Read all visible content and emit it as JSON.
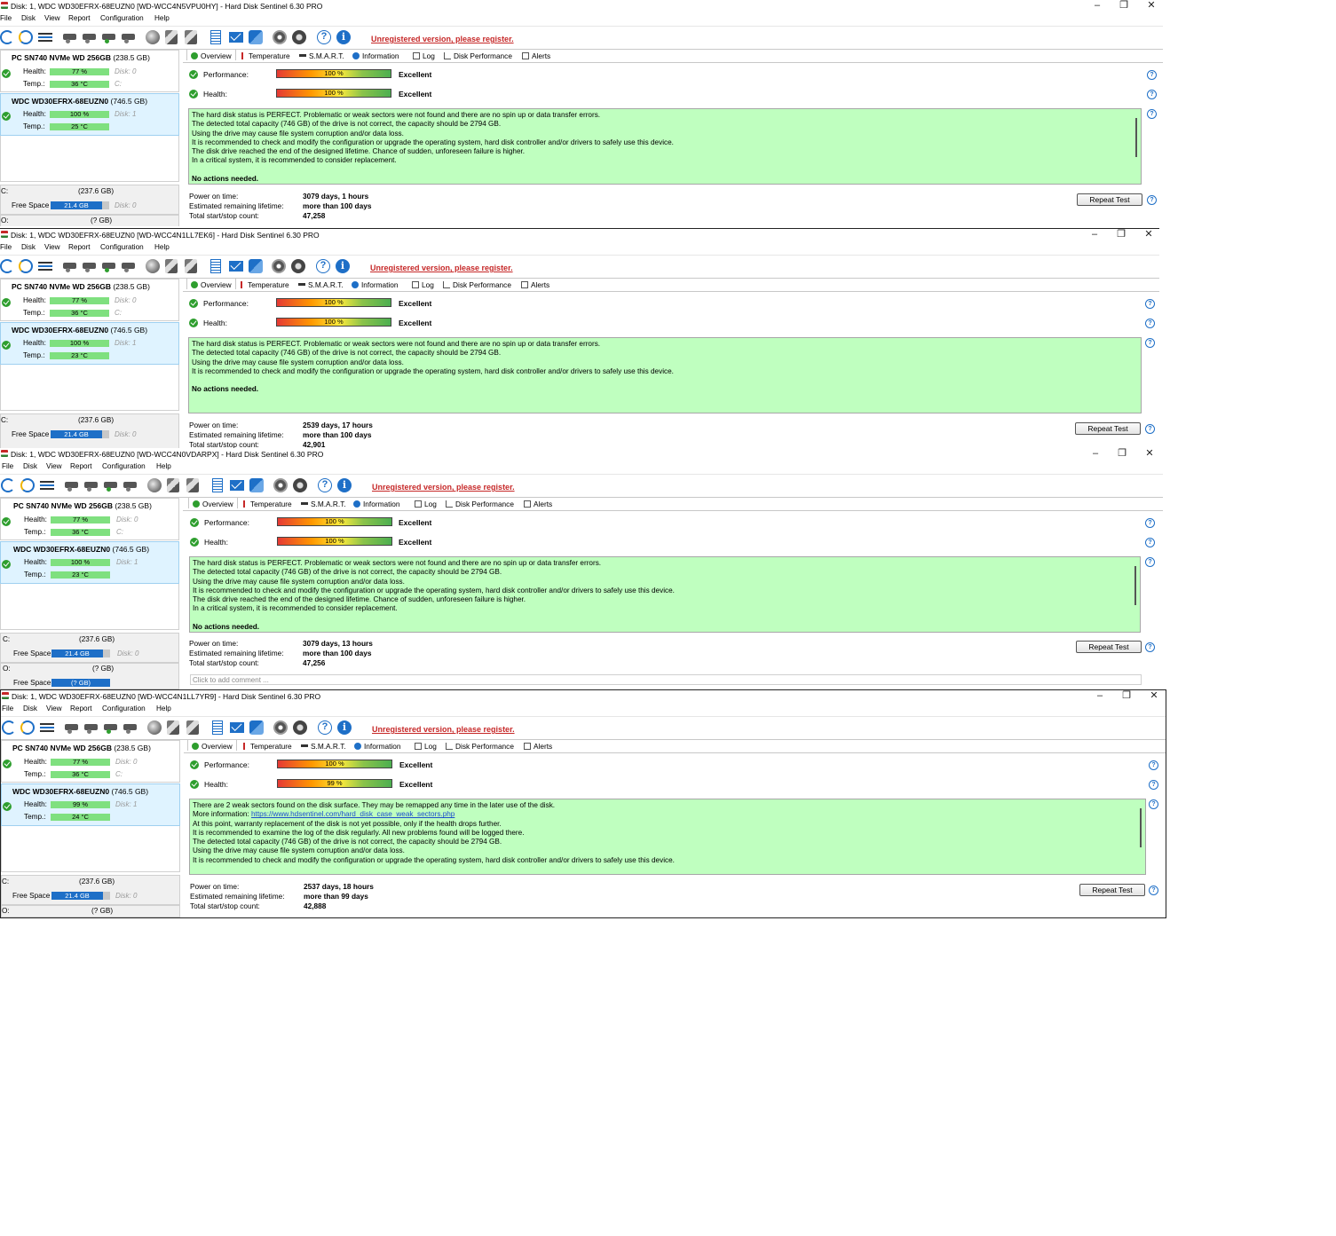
{
  "colors": {
    "accent": "#1e6fc7",
    "healthy": "#2e9e2e",
    "message_bg": "#bfffbf",
    "warning_link": "#c62828",
    "selected_disk_bg": "#dff3ff"
  },
  "menu": [
    "File",
    "Disk",
    "View",
    "Report",
    "Configuration",
    "Help"
  ],
  "tabs": [
    "Overview",
    "Temperature",
    "S.M.A.R.T.",
    "Information",
    "Log",
    "Disk Performance",
    "Alerts"
  ],
  "toolbar": {
    "unregistered": "Unregistered version, please register."
  },
  "labels": {
    "health": "Health:",
    "temp": "Temp.:",
    "free_space": "Free Space",
    "performance": "Performance:",
    "health_main": "Health:",
    "power_on": "Power on time:",
    "remaining": "Estimated remaining lifetime:",
    "startstop": "Total start/stop count:",
    "repeat_test": "Repeat Test",
    "comment": "Click to add comment ..."
  },
  "windows": [
    {
      "title": "Disk: 1, WDC WD30EFRX-68EUZN0 [WD-WCC4N5VPU0HY]  -  Hard Disk Sentinel 6.30 PRO",
      "disks": [
        {
          "name": "PC SN740 NVMe WD 256GB",
          "cap": "(238.5 GB)",
          "health": "77 %",
          "temp": "36 °C",
          "disk_no": "Disk: 0",
          "vol": "C:"
        },
        {
          "name": "WDC WD30EFRX-68EUZN0",
          "cap": "(746.5 GB)",
          "health": "100 %",
          "temp": "25 °C",
          "disk_no": "Disk: 1",
          "vol": ""
        }
      ],
      "vol1": {
        "letter": "C:",
        "cap": "(237.6 GB)",
        "free": "21.4 GB",
        "disk_no": "Disk: 0"
      },
      "vol2": {
        "letter": "O:",
        "cap": "(? GB)"
      },
      "performance": "100 %",
      "health": "100 %",
      "grade_perf": "Excellent",
      "grade_health": "Excellent",
      "messages": [
        "The hard disk status is PERFECT. Problematic or weak sectors were not found and there are no spin up or data transfer errors.",
        "The detected total capacity (746 GB) of the drive is not correct, the capacity should be 2794 GB.",
        "Using the drive may cause file system corruption and/or data loss.",
        "It is recommended to check and modify the configuration or upgrade the operating system, hard disk controller and/or drivers to safely use this device.",
        "The disk drive reached the end of the designed lifetime. Chance of sudden, unforeseen failure is higher.",
        "In a critical system, it is recommended to consider replacement.",
        "",
        "No actions needed."
      ],
      "power_on": "3079 days, 1 hours",
      "remaining": "more than 100 days",
      "startstop": "47,258"
    },
    {
      "title": "Disk: 1, WDC WD30EFRX-68EUZN0 [WD-WCC4N1LL7EK6]  -  Hard Disk Sentinel 6.30 PRO",
      "disks": [
        {
          "name": "PC SN740 NVMe WD 256GB",
          "cap": "(238.5 GB)",
          "health": "77 %",
          "temp": "36 °C",
          "disk_no": "Disk: 0",
          "vol": "C:"
        },
        {
          "name": "WDC WD30EFRX-68EUZN0",
          "cap": "(746.5 GB)",
          "health": "100 %",
          "temp": "23 °C",
          "disk_no": "Disk: 1",
          "vol": ""
        }
      ],
      "vol1": {
        "letter": "C:",
        "cap": "(237.6 GB)",
        "free": "21.4 GB",
        "disk_no": "Disk: 0"
      },
      "performance": "100 %",
      "health": "100 %",
      "grade_perf": "Excellent",
      "grade_health": "Excellent",
      "messages": [
        "The hard disk status is PERFECT. Problematic or weak sectors were not found and there are no spin up or data transfer errors.",
        "The detected total capacity (746 GB) of the drive is not correct, the capacity should be 2794 GB.",
        "Using the drive may cause file system corruption and/or data loss.",
        "It is recommended to check and modify the configuration or upgrade the operating system, hard disk controller and/or drivers to safely use this device.",
        "",
        "No actions needed."
      ],
      "power_on": "2539 days, 17 hours",
      "remaining": "more than 100 days",
      "startstop": "42,901"
    },
    {
      "title": "Disk: 1, WDC WD30EFRX-68EUZN0 [WD-WCC4N0VDARPX]  -  Hard Disk Sentinel 6.30 PRO",
      "disks": [
        {
          "name": "PC SN740 NVMe WD 256GB",
          "cap": "(238.5 GB)",
          "health": "77 %",
          "temp": "36 °C",
          "disk_no": "Disk: 0",
          "vol": "C:"
        },
        {
          "name": "WDC WD30EFRX-68EUZN0",
          "cap": "(746.5 GB)",
          "health": "100 %",
          "temp": "23 °C",
          "disk_no": "Disk: 1",
          "vol": ""
        }
      ],
      "vol1": {
        "letter": "C:",
        "cap": "(237.6 GB)",
        "free": "21.4 GB",
        "disk_no": "Disk: 0"
      },
      "vol2": {
        "letter": "O:",
        "cap": "(? GB)",
        "free": "(? GB)"
      },
      "performance": "100 %",
      "health": "100 %",
      "grade_perf": "Excellent",
      "grade_health": "Excellent",
      "messages": [
        "The hard disk status is PERFECT. Problematic or weak sectors were not found and there are no spin up or data transfer errors.",
        "The detected total capacity (746 GB) of the drive is not correct, the capacity should be 2794 GB.",
        "Using the drive may cause file system corruption and/or data loss.",
        "It is recommended to check and modify the configuration or upgrade the operating system, hard disk controller and/or drivers to safely use this device.",
        "The disk drive reached the end of the designed lifetime. Chance of sudden, unforeseen failure is higher.",
        "In a critical system, it is recommended to consider replacement.",
        "",
        "No actions needed."
      ],
      "power_on": "3079 days, 13 hours",
      "remaining": "more than 100 days",
      "startstop": "47,256"
    },
    {
      "title": "Disk: 1, WDC WD30EFRX-68EUZN0 [WD-WCC4N1LL7YR9]  -  Hard Disk Sentinel 6.30 PRO",
      "disks": [
        {
          "name": "PC SN740 NVMe WD 256GB",
          "cap": "(238.5 GB)",
          "health": "77 %",
          "temp": "36 °C",
          "disk_no": "Disk: 0",
          "vol": "C:"
        },
        {
          "name": "WDC WD30EFRX-68EUZN0",
          "cap": "(746.5 GB)",
          "health": "99 %",
          "temp": "24 °C",
          "disk_no": "Disk: 1",
          "vol": ""
        }
      ],
      "vol1": {
        "letter": "C:",
        "cap": "(237.6 GB)",
        "free": "21.4 GB",
        "disk_no": "Disk: 0"
      },
      "vol2": {
        "letter": "O:",
        "cap": "(? GB)"
      },
      "performance": "100 %",
      "health": "99 %",
      "grade_perf": "Excellent",
      "grade_health": "Excellent",
      "messages_pre": "There are 2 weak sectors found on the disk surface. They may be remapped any time in the later use of the disk.",
      "more_info_label": "More information: ",
      "more_info_link": "https://www.hdsentinel.com/hard_disk_case_weak_sectors.php",
      "messages": [
        "At this point, warranty replacement of the disk is not yet possible, only if the health drops further.",
        "It is recommended to examine the log of the disk regularly. All new problems found will be logged there.",
        "The detected total capacity (746 GB) of the drive is not correct, the capacity should be 2794 GB.",
        "Using the drive may cause file system corruption and/or data loss.",
        "It is recommended to check and modify the configuration or upgrade the operating system, hard disk controller and/or drivers to safely use this device."
      ],
      "power_on": "2537 days, 18 hours",
      "remaining": "more than 99 days",
      "startstop": "42,888"
    }
  ]
}
